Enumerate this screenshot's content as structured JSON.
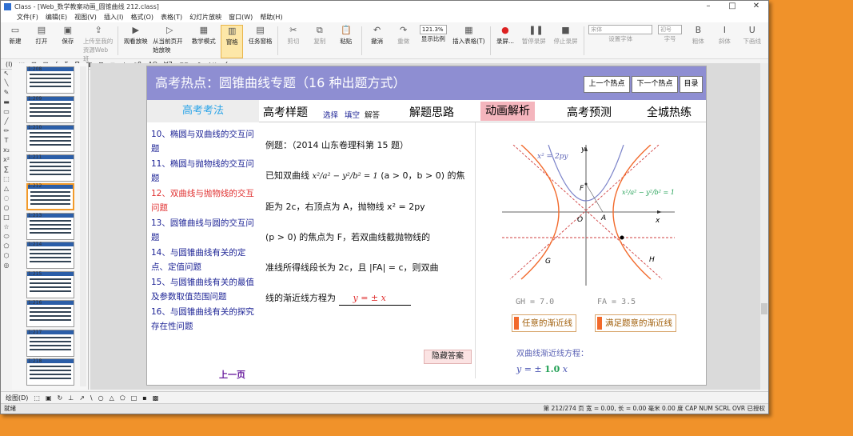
{
  "window": {
    "title": "Class - [Web_数学教案动画_圆锥曲线 212.class]"
  },
  "menu": [
    "文件(F)",
    "编辑(E)",
    "视图(V)",
    "插入(I)",
    "格式(O)",
    "表格(T)",
    "幻灯片放映",
    "窗口(W)",
    "帮助(H)"
  ],
  "toolbar": {
    "new": "新建",
    "open": "打开",
    "save": "保存",
    "upload": "上传至我的资源Web班",
    "view_show": "观看放映",
    "from_current": "从当前页开始放映",
    "teach_mode": "教学模式",
    "pane": "窗格",
    "task_pane": "任务窗格",
    "cut": "剪切",
    "copy": "复制",
    "paste": "粘贴",
    "undo": "撤消",
    "redo": "重做",
    "zoom": "121.3%",
    "zoom_label": "显示比例",
    "insert_table": "插入表格(T)",
    "record": "录屏...",
    "pause_record": "暂停录屏",
    "stop_record": "停止录屏",
    "font_name": "宋体",
    "font_settings": "设置字体",
    "font_size": "初号",
    "font_size_label": "字号",
    "bold": "粗体",
    "italic": "斜体",
    "underline": "下画线"
  },
  "toolbar2": [
    "(I)",
    "ш",
    "⊞",
    "⊟",
    "∫",
    "Σ",
    "∏",
    "▦",
    "⊓",
    "≡",
    "±",
    "αβ",
    "ΑΩ",
    "∀∃",
    "⊂⊃",
    "↗",
    "∧∨",
    "∠"
  ],
  "thumbs": {
    "labels": [
      "1:208",
      "1:209",
      "1:210",
      "1:211",
      "1:212",
      "1:213",
      "1:214",
      "1:215",
      "1:216",
      "1:217",
      "1:218"
    ]
  },
  "slide": {
    "header_title": "高考热点：圆锥曲线专题（16 种出题方式）",
    "nav": {
      "prev_hot": "上一个热点",
      "next_hot": "下一个热点",
      "toc": "目录"
    },
    "side_head": "高考考法",
    "side_items": [
      "10、椭圆与双曲线的交互问题",
      "11、椭圆与抛物线的交互问题",
      "12、双曲线与抛物线的交互问题",
      "13、圆锥曲线与圆的交互问题",
      "14、与圆锥曲线有关的定点、定值问题",
      "15、与圆锥曲线有关的最值及参数取值范围问题",
      "16、与圆锥曲线有关的探究存在性问题"
    ],
    "prev_page": "上一页",
    "tabs": {
      "sample": "高考样题",
      "choice": "选择",
      "fill": "填空",
      "answer": "解答",
      "thinking": "解题思路",
      "anim": "动画解析",
      "predict": "高考预测",
      "citywide": "全城热练"
    },
    "problem": {
      "line1": "例题：（2014 山东卷理科第 15 题）",
      "line2a": "已知双曲线",
      "line2b": "(a > 0，b > 0) 的焦",
      "line3": "距为 2c，右顶点为 A，抛物线 x² = 2py",
      "line4": "(p > 0) 的焦点为 F，若双曲线截抛物线的",
      "line5": "准线所得线段长为 2c，且 |FA| = c，则双曲",
      "line6a": "线的渐近线方程为",
      "answer": "y = ± x"
    },
    "hide_answer": "隐藏答案",
    "graph": {
      "parabola_label": "x² = 2py",
      "hyperbola_label": "x²/a² − y²/b² = 1",
      "labels": {
        "y": "y",
        "x": "x",
        "F": "F",
        "O": "O",
        "A": "A",
        "G": "G",
        "H": "H"
      },
      "colors": {
        "hyperbola": "#f26a2c",
        "parabola": "#7b83c9",
        "axis": "#333333",
        "dashed": "#d04040"
      }
    },
    "readouts": {
      "gh": "GH = 7.0",
      "fa": "FA = 3.5"
    },
    "buttons": {
      "any_asym": "任意的渐近线",
      "satisfy_asym": "满足题意的渐近线"
    },
    "eq_label": "双曲线渐近线方程：",
    "eq_prefix": "y = ±",
    "eq_coef": "1.0",
    "eq_suffix": "x"
  },
  "bottombar": [
    "绘图(D)",
    "⬚",
    "▣",
    "↻",
    "⊥",
    "↗",
    "\\",
    "○",
    "△",
    "⬠",
    "□",
    "▪",
    "▩"
  ],
  "status": {
    "left": "就绪",
    "right": "第 212/274 页  宽 = 0.00, 长 = 0.00 毫米   0.00 度  CAP NUM SCRL OVR 已授权"
  }
}
